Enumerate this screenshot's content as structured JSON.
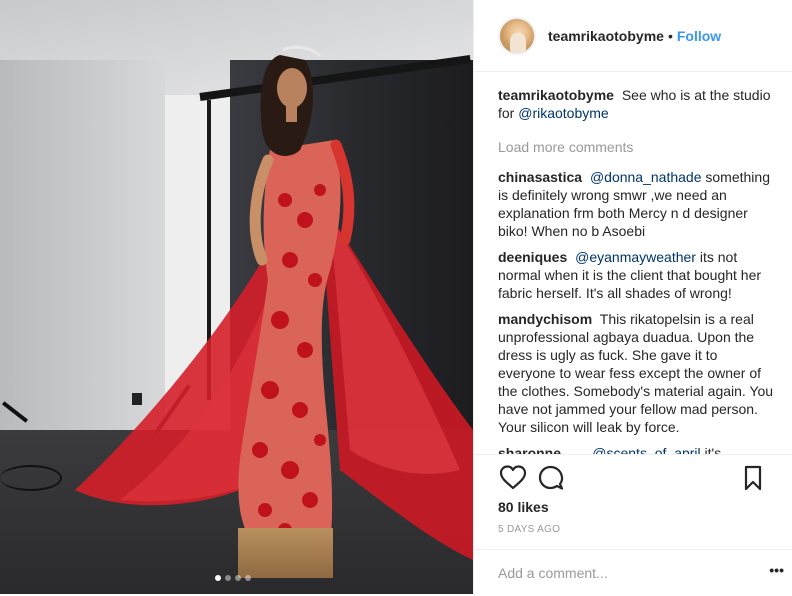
{
  "post": {
    "username": "teamrikaotobyme",
    "separator": "•",
    "follow_label": "Follow",
    "caption": {
      "user": "teamrikaotobyme",
      "text": "See who is at the studio for",
      "mention": "@rikaotobyme"
    },
    "load_more_label": "Load more comments",
    "comments": [
      {
        "user": "chinasastica",
        "mention": "@donna_nathade",
        "text": "something is definitely wrong smwr ,we need an explanation frm both Mercy n d designer biko! When no b Asoebi"
      },
      {
        "user": "deeniques",
        "mention": "@eyanmayweather",
        "text": "its not normal when it is the client that bought her fabric herself. It's all shades of wrong!"
      },
      {
        "user": "mandychisom",
        "mention": "",
        "text": "This rikatopelsin is a real unprofessional agbaya duadua. Upon the dress is ugly as fuck. She gave it to everyone to wear fess except the owner of the clothes. Somebody's material again. You have not jammed your fellow mad person. Your silicon will leak by force."
      },
      {
        "user": "sharonne___",
        "mention": "@scents_of_april",
        "text": "it's obviously not her size"
      }
    ],
    "likes_label": "80 likes",
    "timestamp": "5 DAYS AGO",
    "add_comment_placeholder": "Add a comment...",
    "more_label": "•••",
    "carousel": {
      "count": 4,
      "active_index": 0
    },
    "icons": [
      "heart-icon",
      "comment-icon",
      "bookmark-icon"
    ],
    "colors": {
      "link": "#3897f0",
      "mention": "#003569",
      "muted": "#999999",
      "dress": "#d8262c"
    }
  }
}
